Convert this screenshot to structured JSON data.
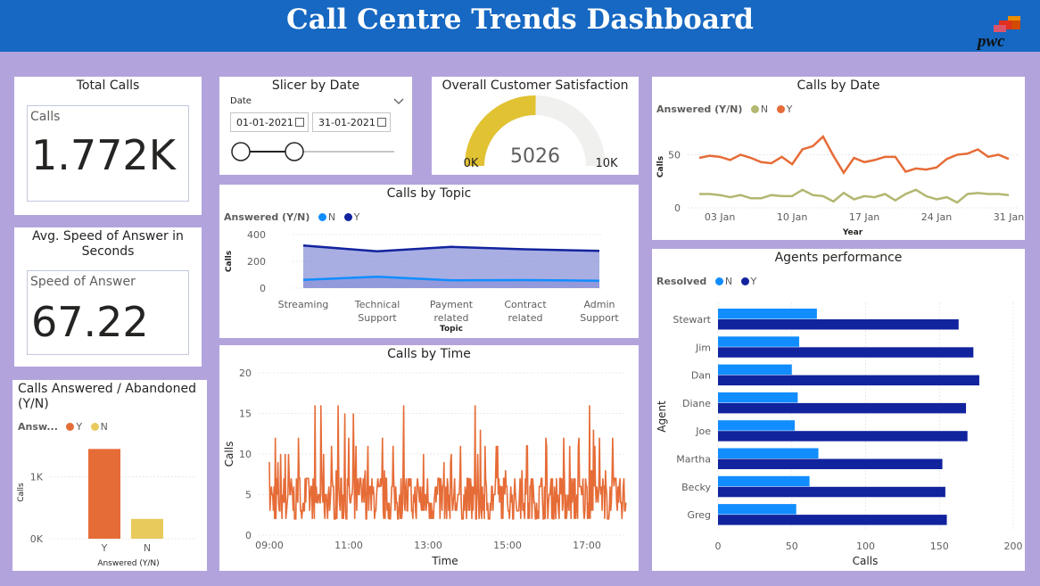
{
  "header": {
    "title": "Call Centre Trends Dashboard",
    "logo_text": "pwc"
  },
  "total_calls": {
    "title": "Total Calls",
    "label": "Calls",
    "value": "1.772K"
  },
  "speed": {
    "title": "Avg. Speed of Answer in Seconds",
    "label": "Speed of Answer",
    "value": "67.22"
  },
  "slicer": {
    "title": "Slicer by Date",
    "label": "Date",
    "start": "01-01-2021",
    "end": "31-01-2021",
    "icons": {
      "calendar": "calendar-icon",
      "chevron": "chevron-down-icon"
    }
  },
  "satisfaction": {
    "title": "Overall Customer Satisfaction",
    "value": "5026",
    "min_label": "0K",
    "max_label": "10K",
    "min": 0,
    "max": 10000,
    "fill_color": "#e1c233"
  },
  "calls_by_topic": {
    "title": "Calls by Topic",
    "legend_title": "Answered (Y/N)",
    "chart_data": {
      "type": "area",
      "categories": [
        "Streaming",
        "Technical Support",
        "Payment related",
        "Contract related",
        "Admin Support"
      ],
      "series": [
        {
          "name": "N",
          "values": [
            62,
            85,
            58,
            60,
            55
          ],
          "color": "#118dff"
        },
        {
          "name": "Y",
          "values": [
            318,
            275,
            308,
            290,
            278
          ],
          "color": "#12239e"
        }
      ],
      "xlabel": "Topic",
      "ylabel": "Calls",
      "ylim": [
        0,
        400
      ],
      "yticks": [
        "0",
        "200",
        "400"
      ]
    }
  },
  "calls_by_date": {
    "title": "Calls by Date",
    "legend_title": "Answered (Y/N)",
    "chart_data": {
      "type": "line",
      "xlabel": "Year",
      "ylabel": "Calls",
      "ylim": [
        0,
        68
      ],
      "yticks": [
        "0",
        "50"
      ],
      "xticks": [
        "03 Jan",
        "10 Jan",
        "17 Jan",
        "24 Jan",
        "31 Jan"
      ],
      "x": [
        "01 Jan",
        "02 Jan",
        "03 Jan",
        "04 Jan",
        "05 Jan",
        "06 Jan",
        "07 Jan",
        "08 Jan",
        "09 Jan",
        "10 Jan",
        "11 Jan",
        "12 Jan",
        "13 Jan",
        "14 Jan",
        "15 Jan",
        "16 Jan",
        "17 Jan",
        "18 Jan",
        "19 Jan",
        "20 Jan",
        "21 Jan",
        "22 Jan",
        "23 Jan",
        "24 Jan",
        "25 Jan",
        "26 Jan",
        "27 Jan",
        "28 Jan",
        "29 Jan",
        "30 Jan",
        "31 Jan"
      ],
      "series": [
        {
          "name": "N",
          "color": "#b3b771",
          "values": [
            13,
            13,
            12,
            10,
            12,
            9,
            9,
            12,
            11,
            11,
            17,
            12,
            11,
            6,
            14,
            8,
            11,
            10,
            13,
            7,
            13,
            17,
            11,
            8,
            10,
            5,
            13,
            14,
            13,
            13,
            12
          ]
        },
        {
          "name": "Y",
          "color": "#e66c37",
          "values": [
            47,
            49,
            48,
            45,
            50,
            47,
            43,
            42,
            48,
            41,
            55,
            58,
            67,
            49,
            33,
            47,
            43,
            45,
            48,
            48,
            34,
            37,
            36,
            38,
            46,
            50,
            51,
            55,
            48,
            50,
            46
          ]
        }
      ]
    }
  },
  "agents": {
    "title": "Agents performance",
    "legend_title": "Resolved",
    "chart_data": {
      "type": "bar",
      "categories": [
        "Stewart",
        "Jim",
        "Dan",
        "Diane",
        "Joe",
        "Martha",
        "Becky",
        "Greg"
      ],
      "series": [
        {
          "name": "N",
          "color": "#118dff",
          "values": [
            67,
            55,
            50,
            54,
            52,
            68,
            62,
            53
          ]
        },
        {
          "name": "Y",
          "color": "#12239e",
          "values": [
            163,
            173,
            177,
            168,
            169,
            152,
            154,
            155
          ]
        }
      ],
      "xlabel": "Calls",
      "ylabel": "Agent",
      "xlim": [
        0,
        200
      ],
      "xticks": [
        "0",
        "50",
        "100",
        "150",
        "200"
      ]
    }
  },
  "answered": {
    "title": "Calls Answered / Abandoned (Y/N)",
    "legend_title": "Answ...",
    "chart_data": {
      "type": "bar",
      "categories": [
        "Y",
        "N"
      ],
      "values": [
        1450,
        320
      ],
      "colors": [
        "#e66c37",
        "#e8c95c"
      ],
      "xlabel": "Answered (Y/N)",
      "ylabel": "Calls",
      "ylim": [
        0,
        1700
      ],
      "yticks": [
        "0K",
        "1K"
      ],
      "legend": [
        "Y",
        "N"
      ]
    }
  },
  "calls_by_time": {
    "title": "Calls by Time",
    "chart_data": {
      "type": "line",
      "xlabel": "Time",
      "ylabel": "Calls",
      "ylim": [
        0,
        20
      ],
      "yticks": [
        "0",
        "5",
        "10",
        "15",
        "20"
      ],
      "xlim": [
        "09:00",
        "17:59"
      ],
      "xticks": [
        "09:00",
        "11:00",
        "13:00",
        "15:00",
        "17:00"
      ],
      "color": "#e66c37"
    }
  }
}
